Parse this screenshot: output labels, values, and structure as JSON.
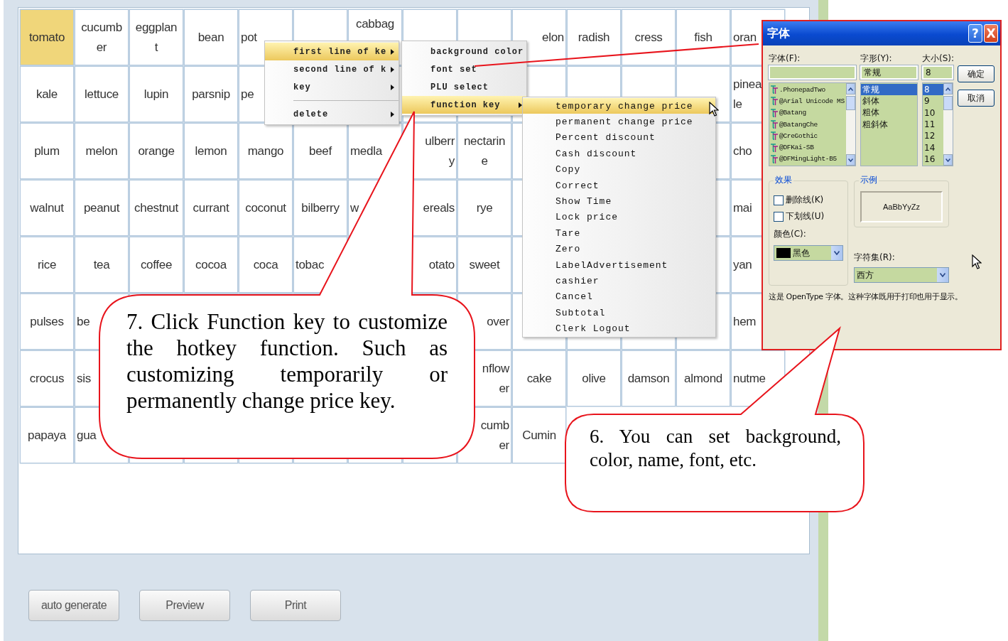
{
  "grid": {
    "rows": [
      [
        {
          "text": "tomato",
          "selected": true
        },
        {
          "text": "cucumb\ner",
          "selected": false
        },
        {
          "text": "eggplan\nt",
          "selected": false
        },
        {
          "text": "bean",
          "selected": false
        },
        {
          "text": "pot",
          "selected": false,
          "kind": "left"
        },
        null,
        {
          "text": "cabbag",
          "selected": false,
          "kind": "top"
        },
        null,
        null,
        {
          "text": "elon",
          "selected": false,
          "kind": "right"
        },
        {
          "text": "radish",
          "selected": false
        },
        {
          "text": "cress",
          "selected": false
        },
        {
          "text": "fish",
          "selected": false
        },
        {
          "text": "oran",
          "selected": false,
          "kind": "left"
        }
      ],
      [
        {
          "text": "kale",
          "selected": false
        },
        {
          "text": "lettuce",
          "selected": false
        },
        {
          "text": "lupin",
          "selected": false
        },
        {
          "text": "parsnip",
          "selected": false
        },
        {
          "text": "pe",
          "selected": false,
          "kind": "left"
        },
        null,
        null,
        null,
        null,
        null,
        null,
        null,
        null,
        {
          "text": "pinea\nle",
          "selected": false,
          "kind": "left"
        }
      ],
      [
        {
          "text": "plum",
          "selected": false
        },
        {
          "text": "melon",
          "selected": false
        },
        {
          "text": "orange",
          "selected": false
        },
        {
          "text": "lemon",
          "selected": false
        },
        {
          "text": "mango",
          "selected": false
        },
        {
          "text": "beef",
          "selected": false
        },
        {
          "text": "medla",
          "selected": false,
          "kind": "left"
        },
        {
          "text": "ulberr\ny",
          "selected": false,
          "kind": "right"
        },
        {
          "text": "nectarin\ne",
          "selected": false
        },
        null,
        null,
        null,
        null,
        {
          "text": "cho",
          "selected": false,
          "kind": "left"
        }
      ],
      [
        {
          "text": "walnut",
          "selected": false
        },
        {
          "text": "peanut",
          "selected": false
        },
        {
          "text": "chestnut",
          "selected": false
        },
        {
          "text": "currant",
          "selected": false
        },
        {
          "text": "coconut",
          "selected": false
        },
        {
          "text": "bilberry",
          "selected": false
        },
        {
          "text": "w",
          "selected": false,
          "kind": "left"
        },
        {
          "text": "ereals",
          "selected": false,
          "kind": "right"
        },
        {
          "text": "rye",
          "selected": false
        },
        null,
        null,
        null,
        null,
        {
          "text": "mai",
          "selected": false,
          "kind": "left"
        }
      ],
      [
        {
          "text": "rice",
          "selected": false
        },
        {
          "text": "tea",
          "selected": false
        },
        {
          "text": "coffee",
          "selected": false
        },
        {
          "text": "cocoa",
          "selected": false
        },
        {
          "text": "coca",
          "selected": false
        },
        {
          "text": "tobac",
          "selected": false,
          "kind": "left"
        },
        null,
        {
          "text": "otato",
          "selected": false,
          "kind": "right"
        },
        {
          "text": "sweet",
          "selected": false
        },
        null,
        null,
        null,
        null,
        {
          "text": "yan",
          "selected": false,
          "kind": "left"
        }
      ],
      [
        {
          "text": "pulses",
          "selected": false
        },
        {
          "text": "be",
          "selected": false,
          "kind": "left"
        },
        null,
        null,
        null,
        null,
        null,
        null,
        {
          "text": "over",
          "selected": false,
          "kind": "right"
        },
        null,
        null,
        null,
        null,
        {
          "text": "hem",
          "selected": false,
          "kind": "left"
        }
      ],
      [
        {
          "text": "crocus",
          "selected": false
        },
        {
          "text": "sis",
          "selected": false,
          "kind": "left"
        },
        null,
        null,
        null,
        null,
        null,
        null,
        {
          "text": "nflow\ner",
          "selected": false,
          "kind": "right"
        },
        {
          "text": "cake",
          "selected": false
        },
        {
          "text": "olive",
          "selected": false
        },
        {
          "text": "damson",
          "selected": false
        },
        {
          "text": "almond",
          "selected": false
        },
        {
          "text": "nutme",
          "selected": false,
          "kind": "left"
        }
      ],
      [
        {
          "text": "papaya",
          "selected": false
        },
        {
          "text": "gua",
          "selected": false,
          "kind": "left"
        },
        null,
        null,
        null,
        null,
        null,
        null,
        {
          "text": "cumb\ner",
          "selected": false,
          "kind": "right"
        },
        {
          "text": "Cumin",
          "selected": false
        },
        null,
        null,
        null,
        null
      ]
    ]
  },
  "buttons": [
    "auto generate",
    "Preview",
    "Print"
  ],
  "context_menu": {
    "items": [
      {
        "label": "first line of ke",
        "kind": "submenu",
        "selected": true
      },
      {
        "label": "second line of k",
        "kind": "submenu",
        "selected": false
      },
      {
        "label": "key",
        "kind": "submenu",
        "selected": false
      },
      {
        "kind": "separator"
      },
      {
        "label": "delete",
        "kind": "submenu",
        "selected": false
      }
    ]
  },
  "key_submenu": {
    "items": [
      {
        "label": "background color",
        "kind": "item",
        "selected": false
      },
      {
        "label": "font set",
        "kind": "item",
        "selected": false
      },
      {
        "label": "PLU select",
        "kind": "item",
        "selected": false
      },
      {
        "label": "function key",
        "kind": "submenu",
        "selected": true
      }
    ]
  },
  "function_key_menu": {
    "items": [
      {
        "label": "temporary change price",
        "kind": "item",
        "selected": true
      },
      {
        "label": "permanent change price",
        "kind": "item",
        "selected": false
      },
      {
        "label": "Percent discount",
        "kind": "item",
        "selected": false
      },
      {
        "label": "Cash discount",
        "kind": "item",
        "selected": false
      },
      {
        "label": "Copy",
        "kind": "item",
        "selected": false
      },
      {
        "label": "Correct",
        "kind": "item",
        "selected": false
      },
      {
        "label": "Show Time",
        "kind": "item",
        "selected": false
      },
      {
        "label": "Lock price",
        "kind": "item",
        "selected": false
      },
      {
        "label": "Tare",
        "kind": "item",
        "selected": false
      },
      {
        "label": "Zero",
        "kind": "item",
        "selected": false
      },
      {
        "label": "LabelAdvertisement",
        "kind": "item",
        "selected": false
      },
      {
        "label": "cashier",
        "kind": "item",
        "selected": false
      },
      {
        "label": "Cancel",
        "kind": "item",
        "selected": false
      },
      {
        "label": "Subtotal",
        "kind": "item",
        "selected": false
      },
      {
        "label": "Clerk Logout",
        "kind": "item",
        "selected": false
      }
    ]
  },
  "font_dialog": {
    "title": "字体",
    "help_button": "?",
    "close_button": "X",
    "font_label": "字体(F):",
    "style_label": "字形(Y):",
    "size_label": "大小(S):",
    "fonts": [
      ".PhonepadTwo",
      "@Arial Unicode MS",
      "@Batang",
      "@BatangChe",
      "@CreGothic",
      "@DFKai-SB",
      "@DFMingLight-B5"
    ],
    "style_value": "常规",
    "styles": [
      {
        "label": "常规",
        "selected": true
      },
      {
        "label": "斜体",
        "selected": false
      },
      {
        "label": "粗体",
        "selected": false
      },
      {
        "label": "粗斜体",
        "selected": false
      }
    ],
    "size_value": "8",
    "sizes": [
      {
        "label": "8",
        "selected": true
      },
      {
        "label": "9",
        "selected": false
      },
      {
        "label": "10",
        "selected": false
      },
      {
        "label": "11",
        "selected": false
      },
      {
        "label": "12",
        "selected": false
      },
      {
        "label": "14",
        "selected": false
      },
      {
        "label": "16",
        "selected": false
      }
    ],
    "ok_button": "确定",
    "cancel_button": "取消",
    "effects_label": "效果",
    "effects": [
      {
        "label": "删除线(K)",
        "checked": false
      },
      {
        "label": "下划线(U)",
        "checked": false
      }
    ],
    "color_label": "颜色(C):",
    "color_value": "黑色",
    "sample_label": "示例",
    "sample_text": "AaBbYyZz",
    "charset_label": "字符集(R):",
    "charset_value": "西方",
    "note": "这是 OpenType 字体。这种字体既用于打印也用于显示。"
  },
  "callouts": [
    {
      "text": "7. Click Function key to customize the hotkey function. Such as customizing temporarily or permanently change price key."
    },
    {
      "text": "6. You can set background, color, name, font, etc."
    }
  ]
}
